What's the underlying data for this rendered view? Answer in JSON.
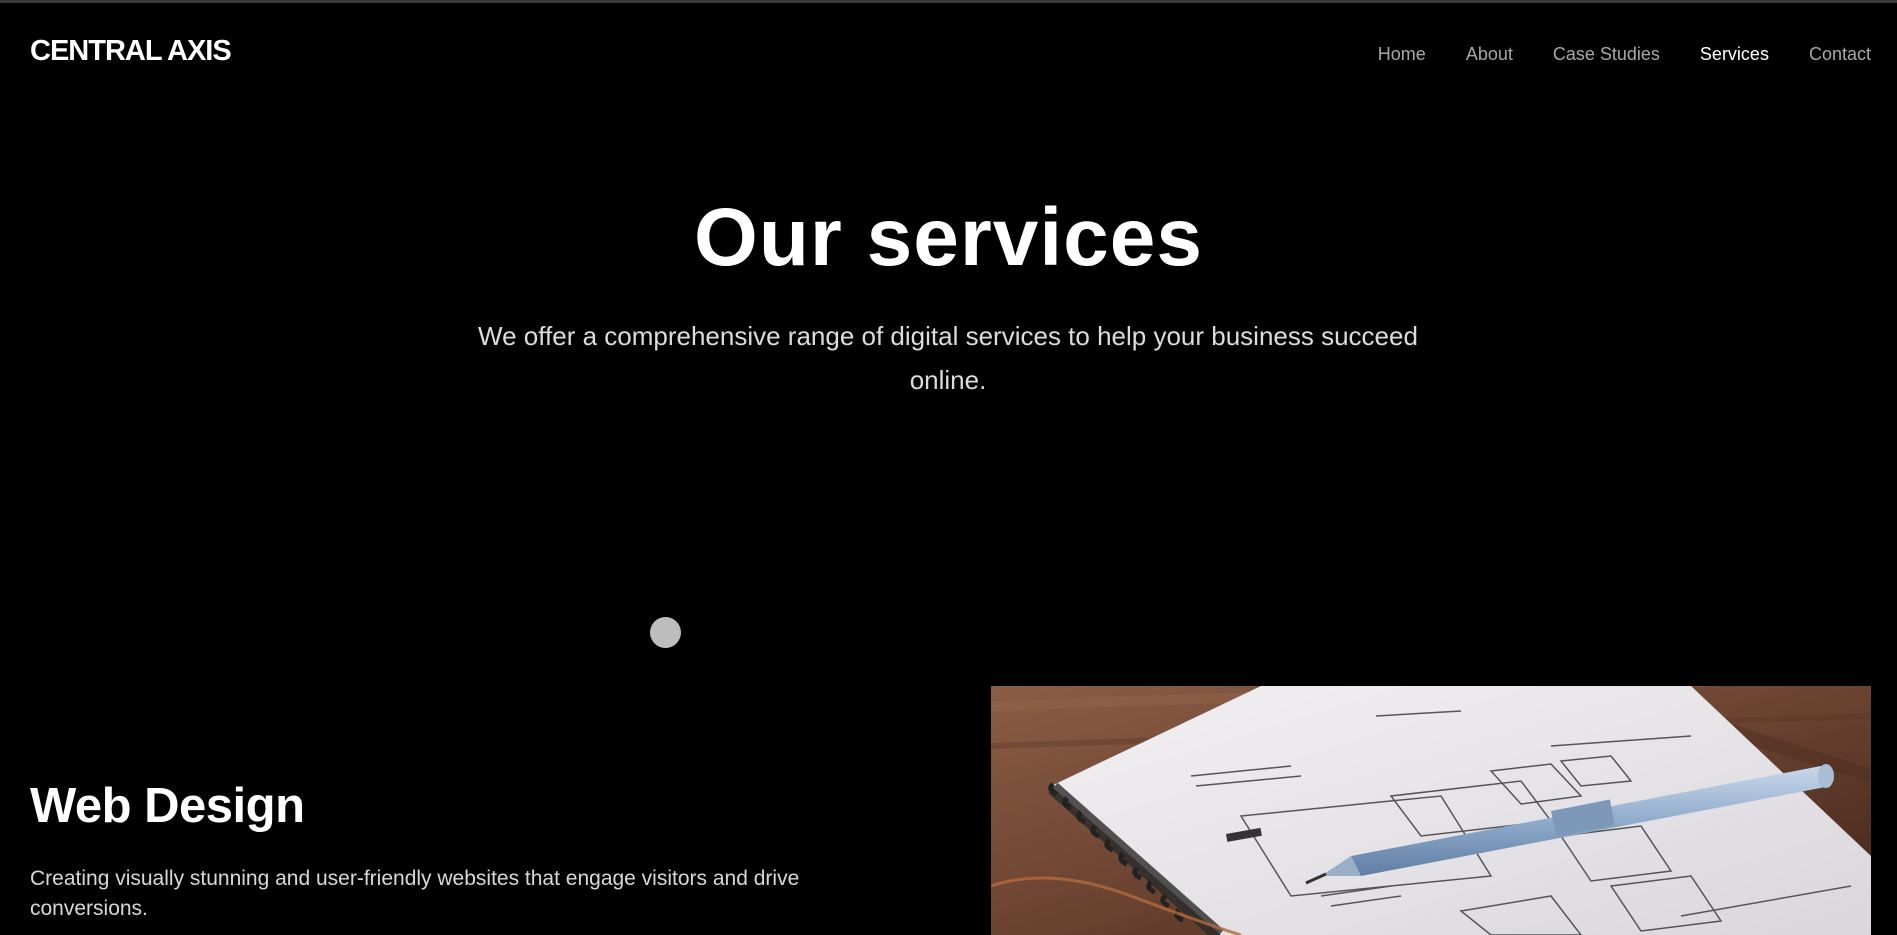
{
  "header": {
    "brand": "CENTRAL AXIS",
    "nav": [
      {
        "label": "Home",
        "active": false
      },
      {
        "label": "About",
        "active": false
      },
      {
        "label": "Case Studies",
        "active": false
      },
      {
        "label": "Services",
        "active": true
      },
      {
        "label": "Contact",
        "active": false
      }
    ]
  },
  "hero": {
    "title": "Our services",
    "subtitle": "We offer a comprehensive range of digital services to help your business succeed online."
  },
  "services": [
    {
      "title": "Web Design",
      "description": "Creating visually stunning and user-friendly websites that engage visitors and drive conversions.",
      "image": "notebook-wireframe-sketch-with-pen"
    }
  ],
  "colors": {
    "background": "#000000",
    "text": "#ffffff",
    "nav_inactive": "#a8a8a8",
    "subtitle": "#dcdcdc",
    "indicator_dot": "#bdbdbd"
  }
}
